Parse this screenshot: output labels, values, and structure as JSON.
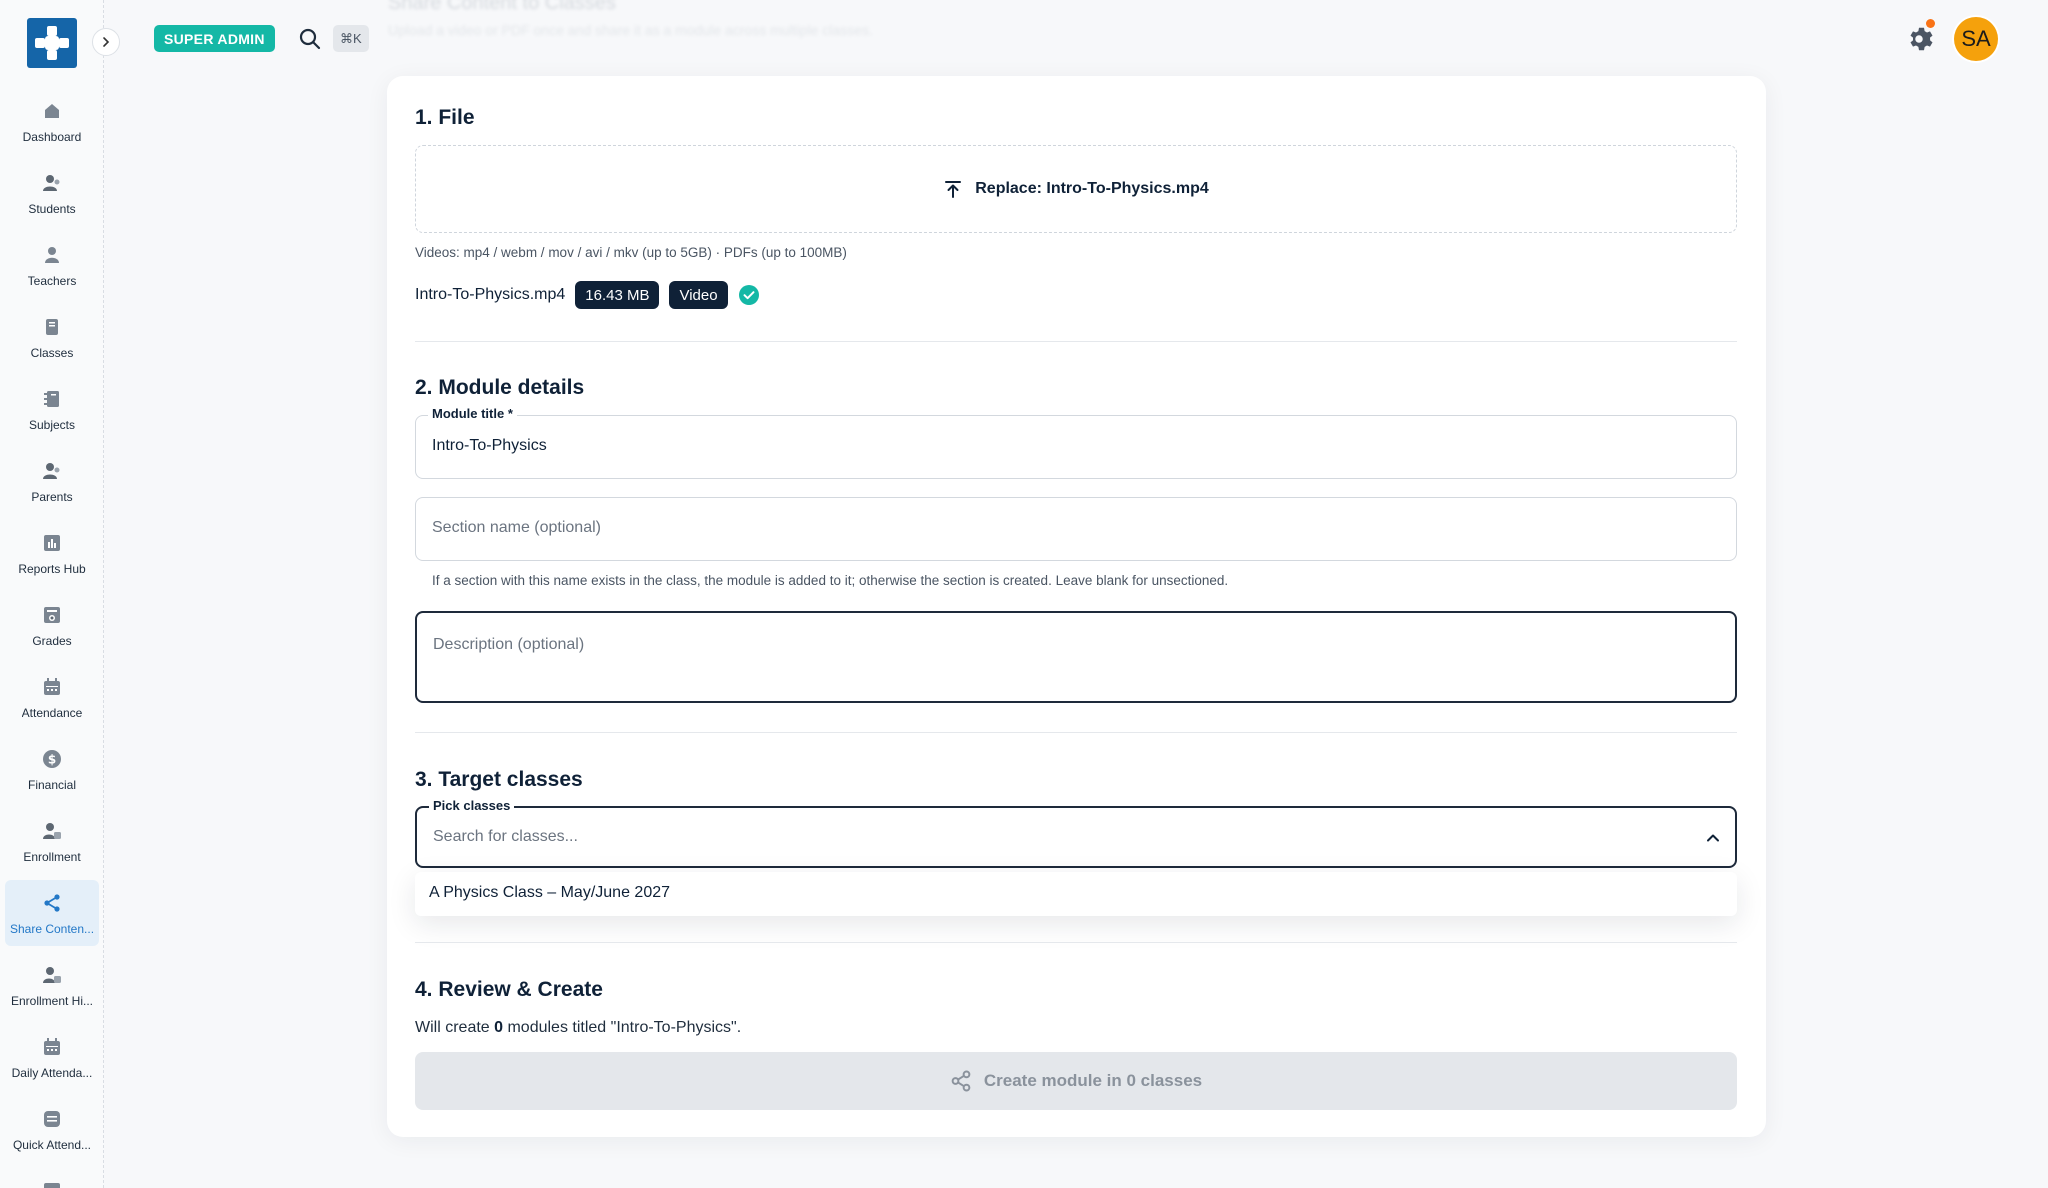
{
  "topbar": {
    "role_badge": "SUPER ADMIN",
    "shortcut": "⌘K",
    "avatar_initials": "SA",
    "ghost_heading": "Share Content to Classes",
    "ghost_subtitle": "Upload a video or PDF once and share it as a module across multiple classes."
  },
  "sidebar": {
    "items": [
      {
        "label": "Dashboard",
        "icon": "home-icon"
      },
      {
        "label": "Students",
        "icon": "students-icon"
      },
      {
        "label": "Teachers",
        "icon": "teacher-icon"
      },
      {
        "label": "Classes",
        "icon": "book-icon"
      },
      {
        "label": "Subjects",
        "icon": "notebook-icon"
      },
      {
        "label": "Parents",
        "icon": "parents-icon"
      },
      {
        "label": "Reports Hub",
        "icon": "chart-icon"
      },
      {
        "label": "Grades",
        "icon": "grades-icon"
      },
      {
        "label": "Attendance",
        "icon": "calendar-icon"
      },
      {
        "label": "Financial",
        "icon": "dollar-icon"
      },
      {
        "label": "Enrollment",
        "icon": "enrollment-icon"
      },
      {
        "label": "Share Conten...",
        "icon": "share-icon"
      },
      {
        "label": "Enrollment Hi...",
        "icon": "enrollment-history-icon"
      },
      {
        "label": "Daily Attenda...",
        "icon": "calendar-icon"
      },
      {
        "label": "Quick Attend...",
        "icon": "quick-attendance-icon"
      }
    ],
    "active": "Share Conten..."
  },
  "file_section": {
    "title": "1. File",
    "replace_label": "Replace: Intro-To-Physics.mp4",
    "help": "Videos: mp4 / webm / mov / avi / mkv (up to 5GB) · PDFs (up to 100MB)",
    "file_name": "Intro-To-Physics.mp4",
    "file_size": "16.43 MB",
    "file_type": "Video"
  },
  "details_section": {
    "title": "2. Module details",
    "module_title_label": "Module title *",
    "module_title_value": "Intro-To-Physics",
    "section_placeholder": "Section name (optional)",
    "section_help": "If a section with this name exists in the class, the module is added to it; otherwise the section is created. Leave blank for unsectioned.",
    "description_placeholder": "Description (optional)"
  },
  "target_section": {
    "title": "3. Target classes",
    "pick_label": "Pick classes",
    "search_placeholder": "Search for classes...",
    "options": [
      "A Physics Class – May/June 2027"
    ]
  },
  "review_section": {
    "title": "4. Review & Create",
    "text_prefix": "Will create ",
    "count": "0",
    "text_suffix": " modules titled \"Intro-To-Physics\".",
    "button_label": "Create module in 0 classes"
  },
  "colors": {
    "brand": "#1565a8",
    "accent_teal": "#14b8a6",
    "navy": "#0f2137",
    "active_nav": "#2378c7",
    "avatar": "#f5a10c",
    "notification": "#f97316"
  }
}
